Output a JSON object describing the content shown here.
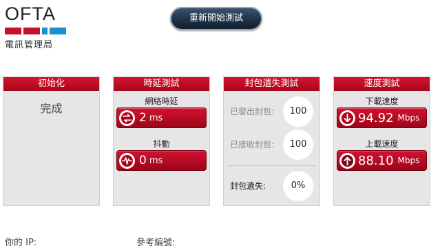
{
  "logo": {
    "text": "OFTA",
    "subtitle": "電訊管理局"
  },
  "restart_button": "重新開始測試",
  "panels": {
    "init": {
      "title": "初始化",
      "status": "完成"
    },
    "latency": {
      "title": "時延測試",
      "network_latency": {
        "label": "網絡時延",
        "value": "2",
        "unit": "ms",
        "icon": "latency-arrows-icon"
      },
      "jitter": {
        "label": "抖動",
        "value": "0",
        "unit": "ms",
        "icon": "jitter-pulse-icon"
      }
    },
    "packet_loss": {
      "title": "封包遺失測試",
      "sent": {
        "label": "已發出封包:",
        "value": "100"
      },
      "received": {
        "label": "已接收封包:",
        "value": "100"
      },
      "lost": {
        "label": "封包遺失:",
        "value": "0%"
      }
    },
    "speed": {
      "title": "速度測試",
      "download": {
        "label": "下載速度",
        "value": "94.92",
        "unit": "Mbps",
        "icon": "download-arrow-icon"
      },
      "upload": {
        "label": "上載速度",
        "value": "88.10",
        "unit": "Mbps",
        "icon": "upload-arrow-icon"
      }
    }
  },
  "footer": {
    "ip_label": "你的 IP:",
    "ref_label": "參考編號:"
  },
  "colors": {
    "accent_red": "#c8102e",
    "accent_blue": "#1b8fd0",
    "button_navy": "#1f3248"
  }
}
